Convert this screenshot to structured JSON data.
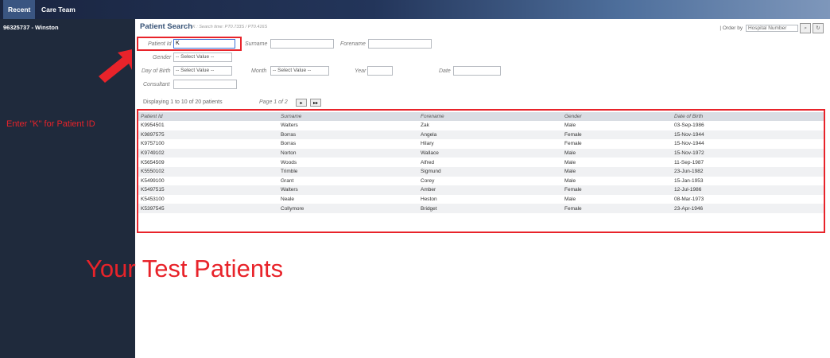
{
  "tabs": {
    "recent": "Recent",
    "care_team": "Care Team"
  },
  "sidebar": {
    "item": "96325737 - Winston",
    "annotation": "Enter \"K\" for Patient ID"
  },
  "search": {
    "title": "Patient Search",
    "subtitle": "K : Search time: PT0.733S / PT0.416S",
    "patient_id_label": "Patient Id",
    "patient_id_value": "K",
    "surname_label": "Surname",
    "forename_label": "Forename",
    "gender_label": "Gender",
    "gender_value": "-- Select Value --",
    "dob_label": "Day of Birth",
    "dob_value": "-- Select Value --",
    "month_label": "Month",
    "month_value": "-- Select Value --",
    "year_label": "Year",
    "date_label": "Date",
    "consultant_label": "Consultant",
    "order_by_label": "| Order by",
    "order_by_value": "Hospital Number"
  },
  "results": {
    "displaying": "Displaying 1 to 10 of 20 patients",
    "page": "Page 1 of 2",
    "next": "▸",
    "last": "▸▸",
    "headers": [
      "Patient Id",
      "Surname",
      "Forename",
      "Gender",
      "Date of Birth"
    ],
    "rows": [
      [
        "K9954501",
        "Walters",
        "Zak",
        "Male",
        "03-Sep-1986"
      ],
      [
        "K9897575",
        "Borras",
        "Angela",
        "Female",
        "15-Nov-1944"
      ],
      [
        "K9757100",
        "Borras",
        "Hilary",
        "Female",
        "15-Nov-1944"
      ],
      [
        "K9749102",
        "Norton",
        "Wallace",
        "Male",
        "15-Nov-1972"
      ],
      [
        "K5654509",
        "Woods",
        "Alfred",
        "Male",
        "11-Sep-1987"
      ],
      [
        "K5550102",
        "Trimble",
        "Sigmund",
        "Male",
        "23-Jun-1982"
      ],
      [
        "K5499100",
        "Grant",
        "Corey",
        "Male",
        "15-Jan-1953"
      ],
      [
        "K5497515",
        "Walters",
        "Amber",
        "Female",
        "12-Jul-1986"
      ],
      [
        "K5453100",
        "Neale",
        "Heston",
        "Male",
        "08-Mar-1973"
      ],
      [
        "K5397545",
        "Collymore",
        "Bridget",
        "Female",
        "23-Apr-1946"
      ]
    ]
  },
  "annotation_big": "Your Test Patients",
  "colors": {
    "annotation": "#e8232a",
    "sidebar": "#1f2a3c"
  }
}
